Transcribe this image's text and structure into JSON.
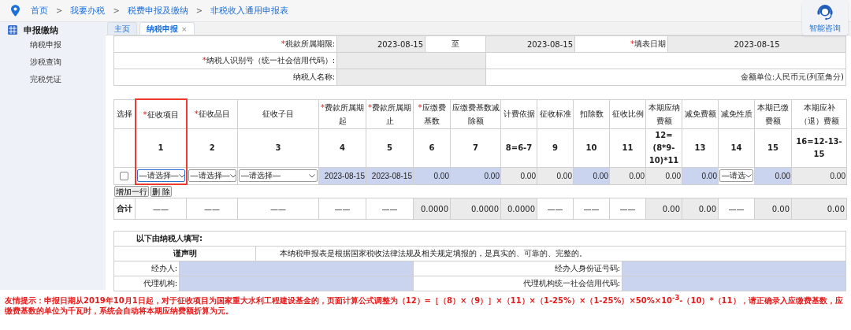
{
  "breadcrumb": [
    {
      "kind": "link",
      "text": "首页"
    },
    {
      "kind": "separator",
      "text": ">"
    },
    {
      "kind": "link",
      "text": "我要办税"
    },
    {
      "kind": "separator",
      "text": ">"
    },
    {
      "kind": "link",
      "text": "税费申报及缴纳"
    },
    {
      "kind": "separator",
      "text": ">"
    },
    {
      "kind": "link",
      "text": "非税收入通用申报表"
    }
  ],
  "consult_button": {
    "label": "智能咨询"
  },
  "sidebar": {
    "title": "申报缴纳",
    "items": [
      {
        "label": "纳税申报"
      },
      {
        "label": "涉税查询"
      },
      {
        "label": "完税凭证"
      }
    ]
  },
  "tabs": [
    {
      "label": "主页",
      "selected": false
    },
    {
      "label": "纳税申报",
      "selected": true,
      "close": "×"
    }
  ],
  "info": {
    "period": {
      "mark": "*",
      "label": "税款所属期限:",
      "from": "2023-08-15",
      "to_label": "至",
      "to": "2023-08-15"
    },
    "fill_date": {
      "mark": "*",
      "label": "填表日期",
      "value": "2023-08-15"
    },
    "taxpayer_id": {
      "mark": "*",
      "label": "纳税人识别号（统一社会信用代码）:"
    },
    "taxpayer_name": {
      "label": "纳税人名称:"
    },
    "unit_note": "金额单位:人民币元(列至角分)"
  },
  "table": {
    "columns": [
      {
        "label": "选择",
        "highlighted": false
      },
      {
        "mark": "*",
        "label": "征收项目",
        "number": "1",
        "highlighted": true
      },
      {
        "mark": "*",
        "label": "征收品目",
        "number": "2",
        "highlighted": false
      },
      {
        "label": "征收子目",
        "number": "3",
        "highlighted": false
      },
      {
        "mark": "*",
        "label": "费款所属期起",
        "number": "4",
        "highlighted": false
      },
      {
        "mark": "*",
        "label": "费款所属期止",
        "number": "5",
        "highlighted": false
      },
      {
        "mark": "*",
        "label": "应缴费基数",
        "number": "6",
        "highlighted": false
      },
      {
        "label": "应缴费基数减除额",
        "number": "7",
        "highlighted": false
      },
      {
        "label": "计费依据",
        "number": "8=6-7",
        "highlighted": false
      },
      {
        "label": "征收标准",
        "number": "9",
        "highlighted": false
      },
      {
        "label": "扣除数",
        "number": "10",
        "highlighted": false
      },
      {
        "label": "征收比例",
        "number": "11",
        "highlighted": false
      },
      {
        "label": "本期应纳费额",
        "number": "12=(8*9-10)*11",
        "highlighted": false
      },
      {
        "label": "减免费额",
        "number": "13",
        "highlighted": false
      },
      {
        "label": "减免性质",
        "number": "14",
        "highlighted": false
      },
      {
        "label": "本期已缴费额",
        "number": "15",
        "highlighted": false
      },
      {
        "label": "本期应补（退）费额",
        "number": "16=12-13-15",
        "highlighted": false
      }
    ],
    "row": {
      "cells": [
        {
          "kind": "checkbox",
          "checked": false
        },
        {
          "kind": "select",
          "value": "—请选择—",
          "focused": true
        },
        {
          "kind": "select",
          "value": "—请选择—",
          "focused": false
        },
        {
          "kind": "select",
          "value": "—请选择—",
          "focused": false
        },
        {
          "kind": "value",
          "text": "2023-08-15",
          "editable": true
        },
        {
          "kind": "value",
          "text": "2023-08-15",
          "editable": true
        },
        {
          "kind": "value",
          "text": "0.00",
          "editable": true
        },
        {
          "kind": "value",
          "text": "0.00",
          "editable": true
        },
        {
          "kind": "value",
          "text": "0.00",
          "editable": false
        },
        {
          "kind": "value",
          "text": "0.00",
          "editable": false
        },
        {
          "kind": "value",
          "text": "0.00",
          "editable": true
        },
        {
          "kind": "value",
          "text": "0.00",
          "editable": false
        },
        {
          "kind": "value",
          "text": "0.00",
          "editable": false
        },
        {
          "kind": "value",
          "text": "0.00",
          "editable": true
        },
        {
          "kind": "select",
          "value": "—请选",
          "focused": false
        },
        {
          "kind": "value",
          "text": "0.00",
          "editable": true
        },
        {
          "kind": "value",
          "text": "0.00",
          "editable": false
        }
      ]
    },
    "buttons": [
      "增加一行",
      "删 除"
    ],
    "total": {
      "label": "合计",
      "cells": [
        {
          "text": "——",
          "filled": false
        },
        {
          "text": "——",
          "filled": false
        },
        {
          "text": "——",
          "filled": false
        },
        {
          "text": "——",
          "filled": false
        },
        {
          "text": "——",
          "filled": false
        },
        {
          "text": "0.0000",
          "filled": true
        },
        {
          "text": "0.0000",
          "filled": true
        },
        {
          "text": "0.0000",
          "filled": true
        },
        {
          "text": "——",
          "filled": false
        },
        {
          "text": "——",
          "filled": false
        },
        {
          "text": "——",
          "filled": false
        },
        {
          "text": "0.00",
          "filled": true
        },
        {
          "text": "0.00",
          "filled": true
        },
        {
          "text": "——",
          "filled": false
        },
        {
          "text": "0.00",
          "filled": true
        },
        {
          "text": "0.00",
          "filled": true
        }
      ]
    }
  },
  "declaration": {
    "heading": "以下由纳税人填写:",
    "statement_label": "谨声明",
    "statement": "本纳税申报表是根据国家税收法律法规及相关规定填报的，是真实的、可靠的、完整的。",
    "fields": [
      {
        "label": "经办人:"
      },
      {
        "label": "经办人身份证号码:"
      },
      {
        "label": "代理机构:"
      },
      {
        "label": "代理机构统一社会信用代码:"
      }
    ]
  },
  "notice": "友情提示：申报日期从2019年10月1日起，对于征收项目为国家重大水利工程建设基金的，页面计算公式调整为（12）=［（8）×（9）］×（11）×（1-25%）×（1-25%）×50%×10$^{-3}$-（10）*（11），请正确录入应缴费基数，应缴费基数的单位为千瓦时，系统会自动将本期应纳费额折算为元。"
}
